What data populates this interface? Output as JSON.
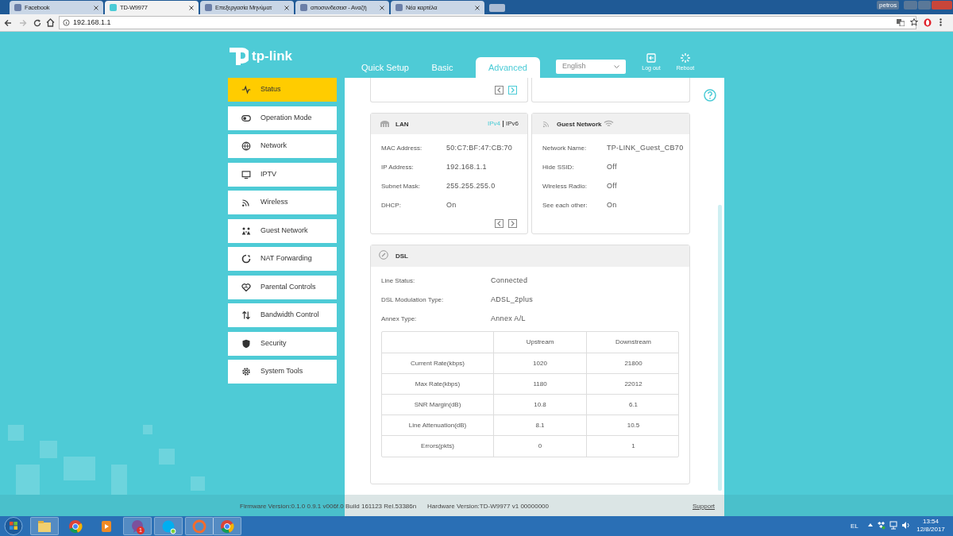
{
  "browser": {
    "tabs": [
      {
        "title": "Facebook",
        "selected": false
      },
      {
        "title": "TD-W9977",
        "selected": true
      },
      {
        "title": "Επεξεργασία Μηνύματ",
        "selected": false
      },
      {
        "title": "αποσυνδεσεισ - Αναζή",
        "selected": false
      },
      {
        "title": "Νέα καρτέλα",
        "selected": false
      }
    ],
    "profile": "petros",
    "address": "192.168.1.1"
  },
  "header": {
    "logo": "tp-link",
    "nav": [
      {
        "label": "Quick Setup",
        "selected": false
      },
      {
        "label": "Basic",
        "selected": false
      },
      {
        "label": "Advanced",
        "selected": true
      }
    ],
    "language": "English",
    "actions": [
      "Log out",
      "Reboot"
    ]
  },
  "sidebar": {
    "items": [
      {
        "label": "Status",
        "selected": true
      },
      {
        "label": "Operation Mode",
        "selected": false
      },
      {
        "label": "Network",
        "selected": false
      },
      {
        "label": "IPTV",
        "selected": false
      },
      {
        "label": "Wireless",
        "selected": false
      },
      {
        "label": "Guest Network",
        "selected": false
      },
      {
        "label": "NAT Forwarding",
        "selected": false
      },
      {
        "label": "Parental Controls",
        "selected": false
      },
      {
        "label": "Bandwidth Control",
        "selected": false
      },
      {
        "label": "Security",
        "selected": false
      },
      {
        "label": "System Tools",
        "selected": false
      }
    ]
  },
  "top_card": {
    "pager": [
      {
        "highlighted": false
      },
      {
        "highlighted": true
      }
    ]
  },
  "lan": {
    "title": "LAN",
    "versions": [
      {
        "label": "IPv4",
        "selected": true
      },
      {
        "label": "IPv6",
        "selected": false
      }
    ],
    "fields": [
      {
        "label": "MAC Address:",
        "value": "50:C7:BF:47:CB:70"
      },
      {
        "label": "IP Address:",
        "value": "192.168.1.1"
      },
      {
        "label": "Subnet Mask:",
        "value": "255.255.255.0"
      },
      {
        "label": "DHCP:",
        "value": "On"
      }
    ],
    "pager": [
      {
        "highlighted": false
      },
      {
        "highlighted": false
      }
    ]
  },
  "guest": {
    "title": "Guest Network",
    "fields": [
      {
        "label": "Network Name:",
        "value": "TP-LINK_Guest_CB70"
      },
      {
        "label": "Hide SSID:",
        "value": "Off"
      },
      {
        "label": "Wireless Radio:",
        "value": "Off"
      },
      {
        "label": "See each other:",
        "value": "On"
      }
    ]
  },
  "dsl": {
    "title": "DSL",
    "fields": [
      {
        "label": "Line Status:",
        "value": "Connected"
      },
      {
        "label": "DSL Modulation Type:",
        "value": "ADSL_2plus"
      },
      {
        "label": "Annex Type:",
        "value": "Annex A/L"
      }
    ],
    "table": {
      "columns": [
        "Upstream",
        "Downstream"
      ],
      "rows": [
        {
          "label": "Current Rate(kbps)",
          "upstream": "1020",
          "downstream": "21800"
        },
        {
          "label": "Max Rate(kbps)",
          "upstream": "1180",
          "downstream": "22012"
        },
        {
          "label": "SNR Margin(dB)",
          "upstream": "10.8",
          "downstream": "6.1"
        },
        {
          "label": "Line Attenuation(dB)",
          "upstream": "8.1",
          "downstream": "10.5"
        },
        {
          "label": "Errors(pkts)",
          "upstream": "0",
          "downstream": "1"
        }
      ]
    }
  },
  "footer": {
    "firmware": "Firmware Version:0.1.0 0.9.1 v006f.0 Build 161123 Rel.53386n",
    "hardware": "Hardware Version:TD-W9977 v1 00000000",
    "support": "Support"
  },
  "taskbar": {
    "badge": "1",
    "language": "EL",
    "time": "13:54",
    "date": "12/8/2017"
  }
}
